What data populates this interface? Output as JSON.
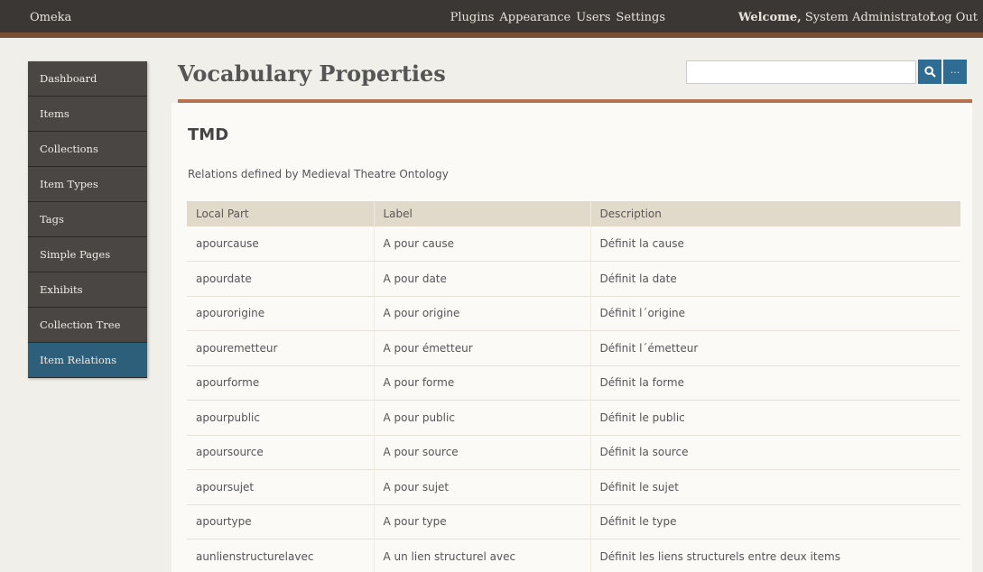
{
  "topbar": {
    "brand": "Omeka",
    "nav": [
      "Plugins",
      "Appearance",
      "Users",
      "Settings"
    ],
    "welcome_prefix": "Welcome,",
    "welcome_user": "System Administrator",
    "logout": "Log Out"
  },
  "sidebar": {
    "items": [
      {
        "label": "Dashboard"
      },
      {
        "label": "Items"
      },
      {
        "label": "Collections"
      },
      {
        "label": "Item Types"
      },
      {
        "label": "Tags"
      },
      {
        "label": "Simple Pages"
      },
      {
        "label": "Exhibits"
      },
      {
        "label": "Collection Tree"
      },
      {
        "label": "Item Relations"
      }
    ],
    "active": "Item Relations"
  },
  "header": {
    "title": "Vocabulary Properties",
    "search_value": "",
    "search_icon": "search-icon",
    "more_label": "..."
  },
  "vocabulary": {
    "name": "TMD",
    "description": "Relations defined by Medieval Theatre Ontology"
  },
  "table": {
    "columns": [
      "Local Part",
      "Label",
      "Description"
    ],
    "rows": [
      [
        "apourcause",
        "A pour cause",
        "Définit la cause"
      ],
      [
        "apourdate",
        "A pour date",
        "Définit la date"
      ],
      [
        "apourorigine",
        "A pour origine",
        "Définit l´origine"
      ],
      [
        "apouremetteur",
        "A pour émetteur",
        "Définit l´émetteur"
      ],
      [
        "apourforme",
        "A pour forme",
        "Définit la forme"
      ],
      [
        "apourpublic",
        "A pour public",
        "Définit le public"
      ],
      [
        "apoursource",
        "A pour source",
        "Définit la source"
      ],
      [
        "apoursujet",
        "A pour sujet",
        "Définit le sujet"
      ],
      [
        "apourtype",
        "A pour type",
        "Définit le type"
      ],
      [
        "aunlienstructurelavec",
        "A un lien structurel avec",
        "Définit les liens structurels entre deux items"
      ]
    ]
  },
  "colors": {
    "topbar_bg": "#3b3735",
    "accent_rule": "#b8714f",
    "active_nav": "#2d5e7a",
    "search_button": "#2e6c94"
  }
}
